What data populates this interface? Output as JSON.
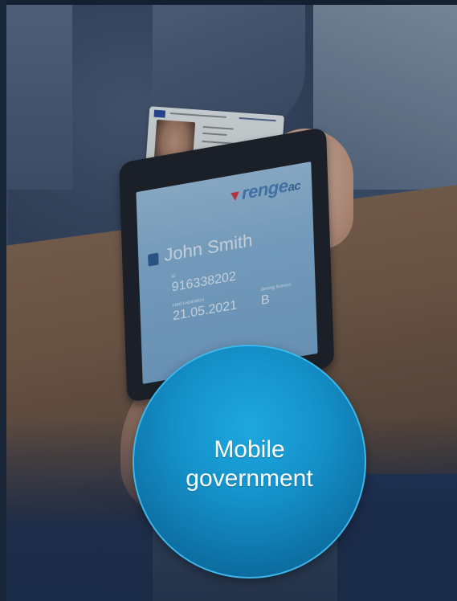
{
  "badge": {
    "line1": "Mobile",
    "line2": "government",
    "color": "#1490c8"
  },
  "photo": {
    "phone_logo": "renge",
    "phone_logo_suffix": "ac",
    "name": "John Smith",
    "id_label": "id",
    "id_number": "916338202",
    "expiry_label": "card expiration",
    "expiry_date": "21.05.2021",
    "class_label": "driving licence",
    "class_value": "B"
  }
}
